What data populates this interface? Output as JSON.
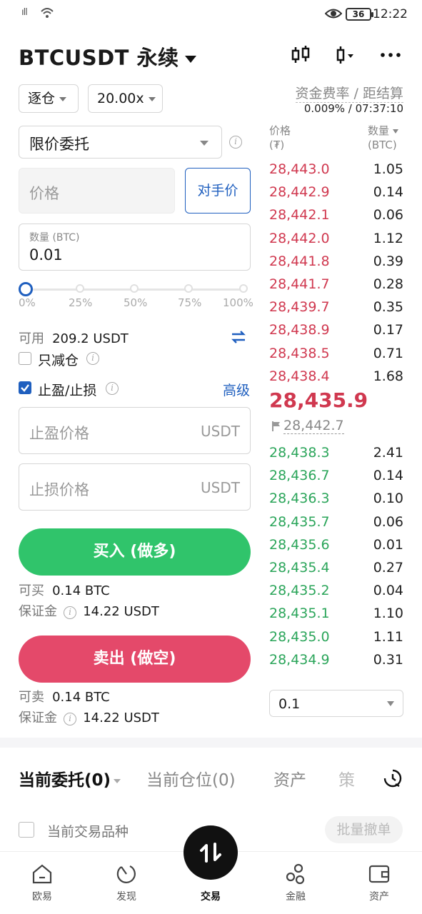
{
  "status_bar": {
    "signal": "ıll",
    "battery": "36",
    "time": "12:22"
  },
  "header": {
    "symbol": "BTCUSDT 永续"
  },
  "margin": {
    "mode": "逐仓",
    "leverage": "20.00x"
  },
  "funding": {
    "label": "资金费率 / 距结算",
    "value": "0.009% / 07:37:10"
  },
  "order": {
    "type": "限价委托",
    "price_placeholder": "价格",
    "counterparty_price": "对手价",
    "qty_label": "数量 (BTC)",
    "qty_value": "0.01",
    "slider_marks": [
      "0%",
      "25%",
      "50%",
      "75%",
      "100%"
    ],
    "slider_value_fraction": 0,
    "available_label": "可用",
    "available_value": "209.2 USDT",
    "reduce_only": "只减仓",
    "tpsl": "止盈/止损",
    "advanced": "高级",
    "tp_placeholder": "止盈价格",
    "sl_placeholder": "止损价格",
    "unit": "USDT",
    "buy_button": "买入 (做多)",
    "buy_can_label": "可买",
    "buy_can_value": "0.14 BTC",
    "margin_label": "保证金",
    "buy_margin_value": "14.22 USDT",
    "sell_button": "卖出 (做空)",
    "sell_can_label": "可卖",
    "sell_can_value": "0.14 BTC",
    "sell_margin_value": "14.22 USDT"
  },
  "orderbook": {
    "price_header": "价格",
    "price_unit": "(₮)",
    "qty_header": "数量",
    "qty_unit": "(BTC)",
    "asks": [
      {
        "price": "28,443.0",
        "qty": "1.05"
      },
      {
        "price": "28,442.9",
        "qty": "0.14"
      },
      {
        "price": "28,442.1",
        "qty": "0.06"
      },
      {
        "price": "28,442.0",
        "qty": "1.12"
      },
      {
        "price": "28,441.8",
        "qty": "0.39"
      },
      {
        "price": "28,441.7",
        "qty": "0.28"
      },
      {
        "price": "28,439.7",
        "qty": "0.35"
      },
      {
        "price": "28,438.9",
        "qty": "0.17"
      },
      {
        "price": "28,438.5",
        "qty": "0.71"
      },
      {
        "price": "28,438.4",
        "qty": "1.68"
      }
    ],
    "last_price": "28,435.9",
    "mark_price": "28,442.7",
    "bids": [
      {
        "price": "28,438.3",
        "qty": "2.41"
      },
      {
        "price": "28,436.7",
        "qty": "0.14"
      },
      {
        "price": "28,436.3",
        "qty": "0.10"
      },
      {
        "price": "28,435.7",
        "qty": "0.06"
      },
      {
        "price": "28,435.6",
        "qty": "0.01"
      },
      {
        "price": "28,435.4",
        "qty": "0.27"
      },
      {
        "price": "28,435.2",
        "qty": "0.04"
      },
      {
        "price": "28,435.1",
        "qty": "1.10"
      },
      {
        "price": "28,435.0",
        "qty": "1.11"
      },
      {
        "price": "28,434.9",
        "qty": "0.31"
      }
    ],
    "depth": "0.1"
  },
  "tabs": [
    "当前委托(0)",
    "当前仓位(0)",
    "资产",
    "策"
  ],
  "filter": {
    "label": "当前交易品种",
    "cancel_all": "批量撤单"
  },
  "nav": [
    "欧易",
    "发现",
    "交易",
    "金融",
    "资产"
  ],
  "colors": {
    "buy": "#30c46b",
    "sell": "#e4496a",
    "accent": "#1f5fbf"
  }
}
